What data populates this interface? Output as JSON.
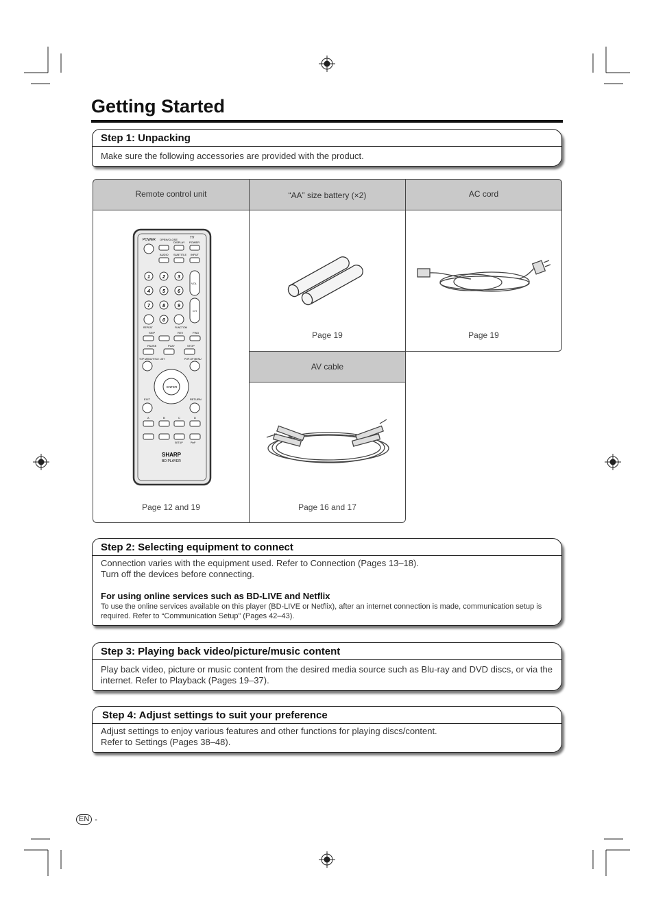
{
  "page_title": "Getting Started",
  "step1": {
    "title": "Step 1: Unpacking",
    "text": "Make sure the following accessories are provided with the product."
  },
  "accessories": [
    {
      "name": "Remote control unit",
      "page": "Page 12 and 19"
    },
    {
      "name": "“AA” size battery (×2)",
      "page": "Page 19"
    },
    {
      "name": "AC cord",
      "page": "Page 19"
    },
    {
      "name": "AV cable",
      "page": "Page 16 and 17"
    }
  ],
  "remote_labels": [
    "POWER",
    "OPEN/CLOSE",
    "DISPLAY",
    "TV",
    "POWER",
    "AUDIO",
    "SUBTITLE",
    "INPUT",
    "VOL",
    "CH",
    "REPEAT",
    "FUNCTION",
    "SKIP",
    "REV",
    "FWD",
    "PAUSE",
    "PLAY",
    "STOP",
    "TOP MENU/TITLE LIST",
    "POP-UP MENU",
    "ENTER",
    "EXIT",
    "RETURN",
    "A",
    "B",
    "C",
    "D",
    "SETUP",
    "PinP",
    "SHARP",
    "BD PLAYER"
  ],
  "step2": {
    "title": "Step 2: Selecting equipment to connect",
    "line1": "Connection varies with the equipment used. Refer to Connection (Pages 13–18).",
    "line2": "Turn off the devices before connecting.",
    "subtitle": "For using online services such as BD-LIVE and Netflix",
    "subtext": "To use the online services available on this player (BD-LIVE or Netflix), after an internet connection is made, communication setup is required. Refer to “Communication Setup” (Pages 42–43)."
  },
  "step3": {
    "title": "Step 3: Playing back video/picture/music content",
    "text": "Play back video, picture or music content from the desired media source such as Blu-ray and DVD discs, or via the internet. Refer to Playback (Pages 19–37)."
  },
  "step4": {
    "title": "Step 4: Adjust settings to suit your preference",
    "line1": "Adjust settings to enjoy various features and other functions for playing discs/content.",
    "line2": "Refer to Settings (Pages 38–48)."
  },
  "footer": {
    "lang": "EN",
    "page": "-"
  }
}
